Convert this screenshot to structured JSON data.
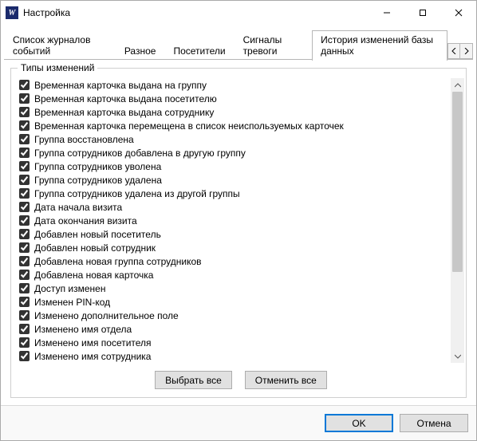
{
  "window": {
    "title": "Настройка"
  },
  "tabs": {
    "items": [
      {
        "label": "Список журналов событий"
      },
      {
        "label": "Разное"
      },
      {
        "label": "Посетители"
      },
      {
        "label": "Сигналы тревоги"
      },
      {
        "label": "История изменений базы данных"
      }
    ],
    "active_index": 4
  },
  "group": {
    "label": "Типы изменений",
    "items": [
      {
        "label": "Временная карточка выдана на группу",
        "checked": true
      },
      {
        "label": "Временная карточка выдана посетителю",
        "checked": true
      },
      {
        "label": "Временная карточка выдана сотруднику",
        "checked": true
      },
      {
        "label": "Временная карточка перемещена в список неиспользуемых карточек",
        "checked": true
      },
      {
        "label": "Группа восстановлена",
        "checked": true
      },
      {
        "label": "Группа сотрудников добавлена в другую группу",
        "checked": true
      },
      {
        "label": "Группа сотрудников уволена",
        "checked": true
      },
      {
        "label": "Группа сотрудников удалена",
        "checked": true
      },
      {
        "label": "Группа сотрудников удалена из другой группы",
        "checked": true
      },
      {
        "label": "Дата начала визита",
        "checked": true
      },
      {
        "label": "Дата окончания визита",
        "checked": true
      },
      {
        "label": "Добавлен новый посетитель",
        "checked": true
      },
      {
        "label": "Добавлен новый сотрудник",
        "checked": true
      },
      {
        "label": "Добавлена новая группа сотрудников",
        "checked": true
      },
      {
        "label": "Добавлена новая карточка",
        "checked": true
      },
      {
        "label": "Доступ изменен",
        "checked": true
      },
      {
        "label": "Изменен PIN-код",
        "checked": true
      },
      {
        "label": "Изменено дополнительное поле",
        "checked": true
      },
      {
        "label": "Изменено имя отдела",
        "checked": true
      },
      {
        "label": "Изменено имя посетителя",
        "checked": true
      },
      {
        "label": "Изменено имя сотрудника",
        "checked": true
      }
    ],
    "select_all_label": "Выбрать все",
    "deselect_all_label": "Отменить все"
  },
  "footer": {
    "ok_label": "OK",
    "cancel_label": "Отмена"
  }
}
